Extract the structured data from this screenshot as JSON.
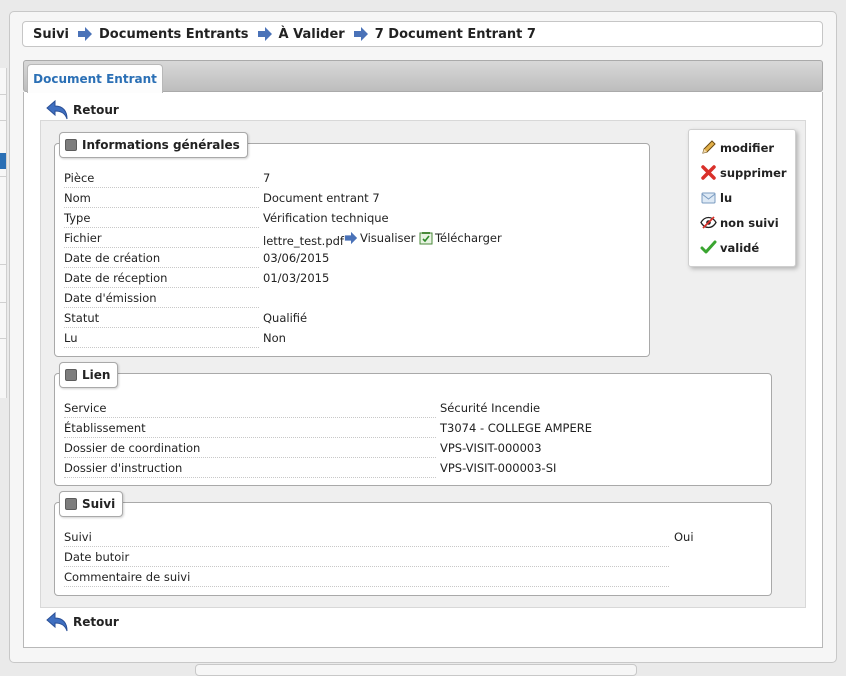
{
  "breadcrumb": [
    "Suivi",
    "Documents Entrants",
    "À Valider",
    "7 Document Entrant 7"
  ],
  "tab_label": "Document Entrant",
  "back_label": "Retour",
  "general": {
    "title": "Informations générales",
    "rows": [
      {
        "label": "Pièce",
        "value": "7"
      },
      {
        "label": "Nom",
        "value": "Document entrant 7"
      },
      {
        "label": "Type",
        "value": "Vérification technique"
      },
      {
        "label": "Fichier",
        "value": "lettre_test.pdf"
      },
      {
        "label": "Date de création",
        "value": "03/06/2015"
      },
      {
        "label": "Date de réception",
        "value": "01/03/2015"
      },
      {
        "label": "Date d'émission",
        "value": ""
      },
      {
        "label": "Statut",
        "value": "Qualifié"
      },
      {
        "label": "Lu",
        "value": "Non"
      }
    ],
    "file_actions": {
      "view": "Visualiser",
      "download": "Télécharger"
    }
  },
  "lien": {
    "title": "Lien",
    "rows": [
      {
        "label": "Service",
        "value": "Sécurité Incendie"
      },
      {
        "label": "Établissement",
        "value": "T3074 - COLLEGE AMPERE"
      },
      {
        "label": "Dossier de coordination",
        "value": "VPS-VISIT-000003"
      },
      {
        "label": "Dossier d'instruction",
        "value": "VPS-VISIT-000003-SI"
      }
    ]
  },
  "suivi": {
    "title": "Suivi",
    "rows": [
      {
        "label": "Suivi",
        "value": "Oui"
      },
      {
        "label": "Date butoir",
        "value": ""
      },
      {
        "label": "Commentaire de suivi",
        "value": ""
      }
    ]
  },
  "actions": [
    {
      "label": "modifier",
      "icon": "pencil-icon"
    },
    {
      "label": "supprimer",
      "icon": "delete-icon"
    },
    {
      "label": "lu",
      "icon": "envelope-icon"
    },
    {
      "label": "non suivi",
      "icon": "eye-slash-icon"
    },
    {
      "label": "validé",
      "icon": "check-icon"
    }
  ],
  "colors": {
    "link": "#2a6fb5",
    "accent": "#4a72b8",
    "delete": "#d9302a",
    "check": "#3aa530"
  }
}
